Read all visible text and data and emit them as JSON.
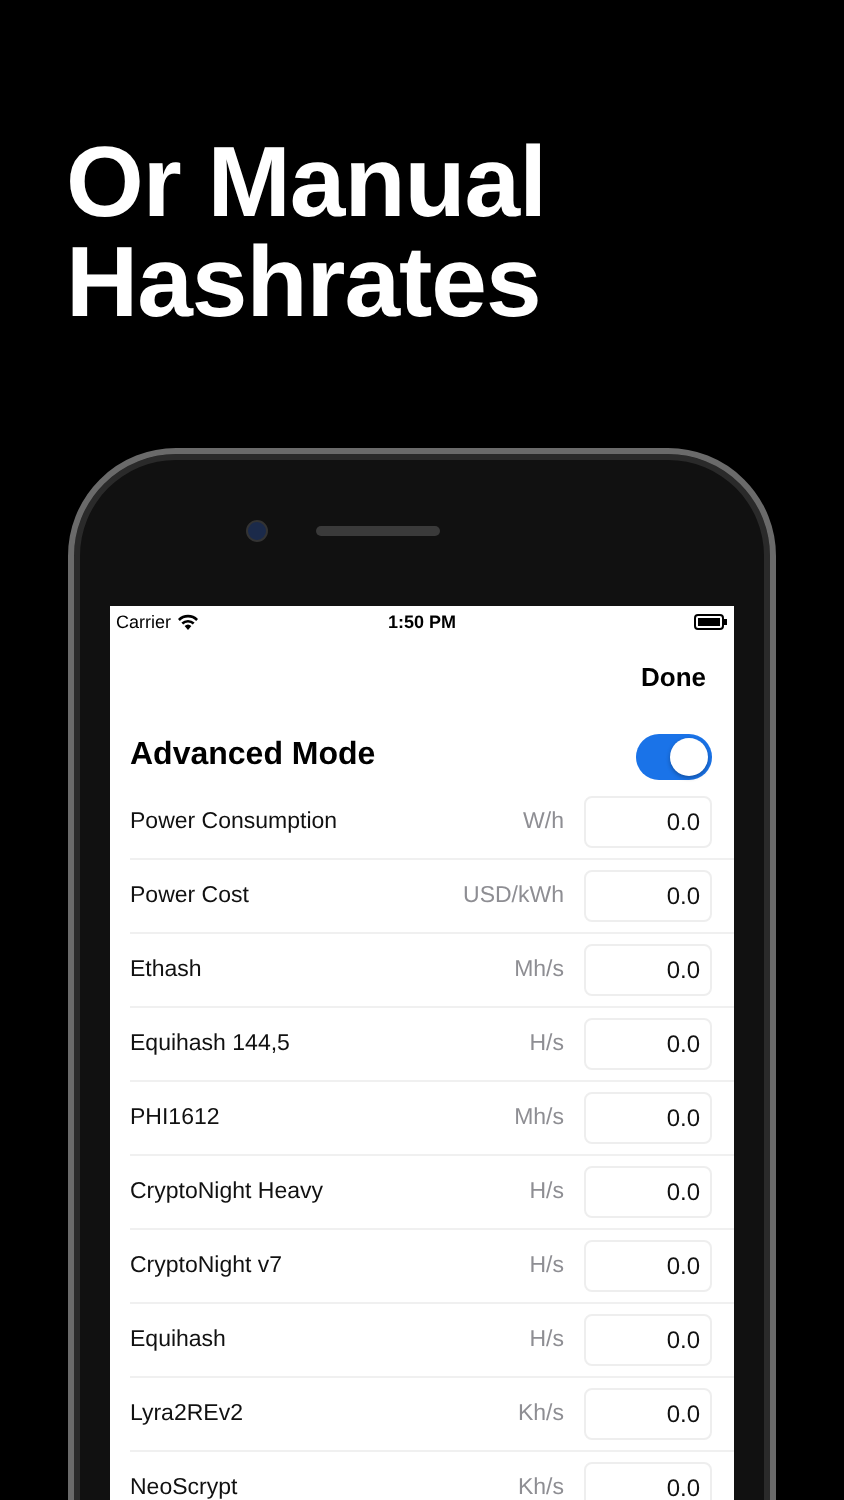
{
  "headline": "Or Manual Hashrates",
  "status_bar": {
    "carrier": "Carrier",
    "time": "1:50 PM"
  },
  "nav": {
    "done": "Done"
  },
  "advanced_mode": {
    "label": "Advanced Mode",
    "on": true
  },
  "rows": [
    {
      "label": "Power Consumption",
      "unit": "W/h",
      "value": "0.0"
    },
    {
      "label": "Power Cost",
      "unit": "USD/kWh",
      "value": "0.0"
    },
    {
      "label": "Ethash",
      "unit": "Mh/s",
      "value": "0.0"
    },
    {
      "label": "Equihash 144,5",
      "unit": "H/s",
      "value": "0.0"
    },
    {
      "label": "PHI1612",
      "unit": "Mh/s",
      "value": "0.0"
    },
    {
      "label": "CryptoNight Heavy",
      "unit": "H/s",
      "value": "0.0"
    },
    {
      "label": "CryptoNight v7",
      "unit": "H/s",
      "value": "0.0"
    },
    {
      "label": "Equihash",
      "unit": "H/s",
      "value": "0.0"
    },
    {
      "label": "Lyra2REv2",
      "unit": "Kh/s",
      "value": "0.0"
    },
    {
      "label": "NeoScrypt",
      "unit": "Kh/s",
      "value": "0.0"
    }
  ]
}
